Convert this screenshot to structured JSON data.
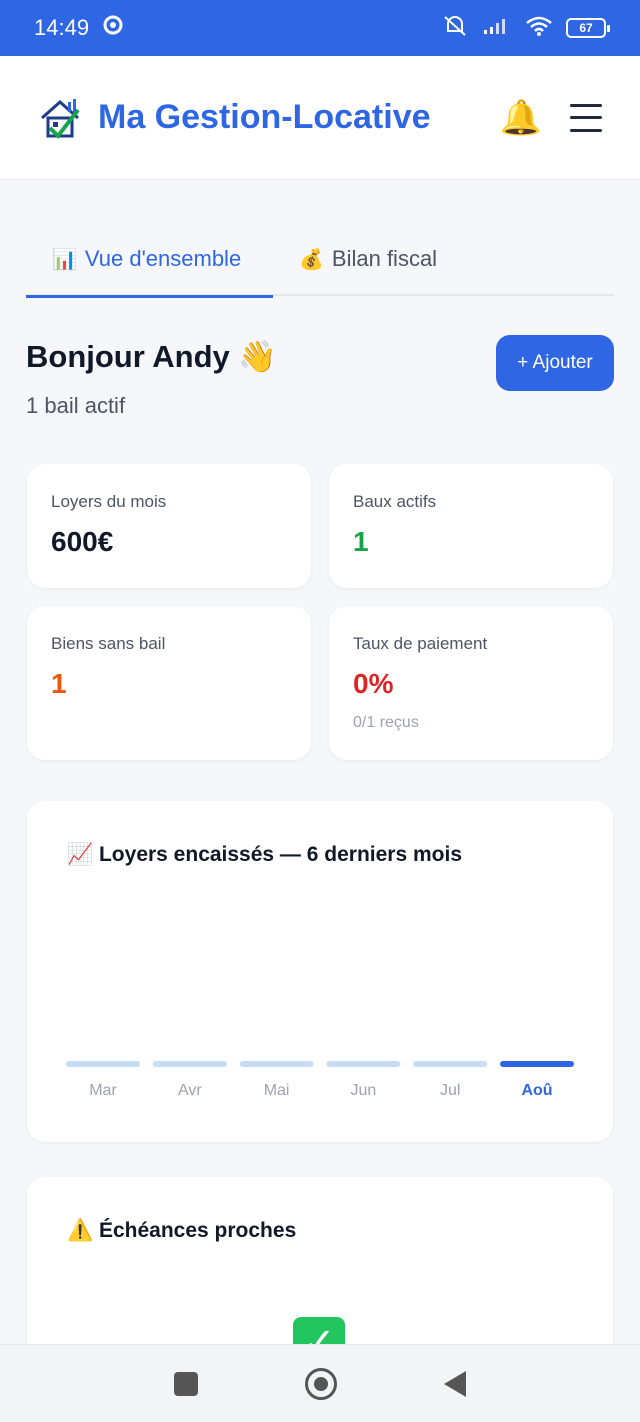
{
  "status_bar": {
    "time": "14:49",
    "battery": "67"
  },
  "app": {
    "title": "Ma Gestion-Locative"
  },
  "tabs": [
    {
      "label": "Vue d'ensemble",
      "icon": "📊",
      "active": true
    },
    {
      "label": "Bilan fiscal",
      "icon": "💰",
      "active": false
    }
  ],
  "greeting": {
    "title": "Bonjour Andy 👋",
    "subtitle": "1 bail actif",
    "add_button": "+ Ajouter"
  },
  "stats": [
    {
      "label": "Loyers du mois",
      "value": "600€",
      "color": "#111827"
    },
    {
      "label": "Baux actifs",
      "value": "1",
      "color": "#16a34a"
    },
    {
      "label": "Biens sans bail",
      "value": "1",
      "color": "#ea580c"
    },
    {
      "label": "Taux de paiement",
      "value": "0%",
      "hint": "0/1 reçus",
      "color": "#dc2626"
    }
  ],
  "colors": {
    "accent": "#2e66e3",
    "bar_light": "#c7dcf7"
  },
  "chart_data": {
    "type": "bar",
    "title": "📈 Loyers encaissés — 6 derniers mois",
    "categories": [
      "Mar",
      "Avr",
      "Mai",
      "Jun",
      "Jul",
      "Aoû"
    ],
    "values": [
      0,
      0,
      0,
      0,
      0,
      0
    ],
    "highlight": "Aoû"
  },
  "echeances": {
    "title": "⚠️ Échéances proches"
  }
}
